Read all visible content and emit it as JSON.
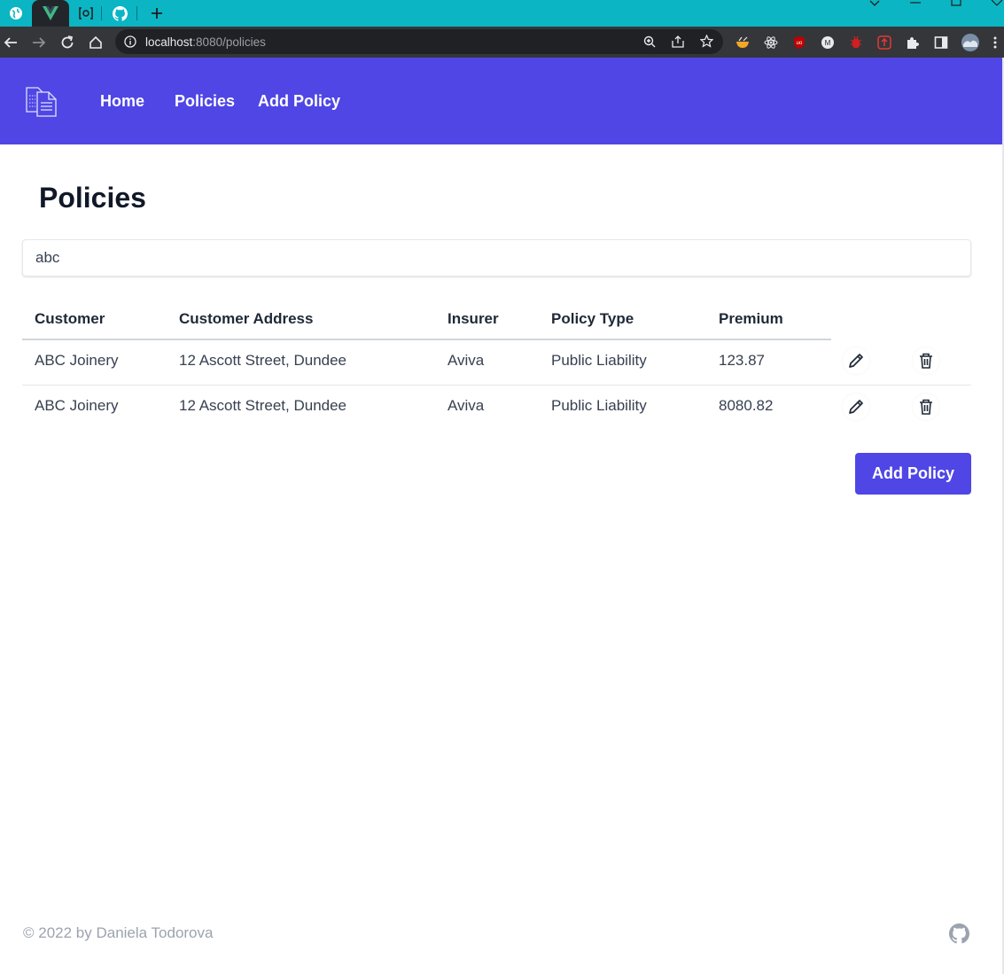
{
  "browser": {
    "url_host": "localhost",
    "url_path": ":8080/policies",
    "tabs": [
      {
        "icon": "globe-icon"
      },
      {
        "icon": "vue-icon",
        "active": true
      },
      {
        "icon": "podman-icon"
      },
      {
        "icon": "github-icon"
      }
    ],
    "new_tab": "+",
    "accent": "#0bb5c4"
  },
  "nav": {
    "brand_icon": "document-stack-icon",
    "links": [
      "Home",
      "Policies",
      "Add Policy"
    ],
    "color": "#4f46e5"
  },
  "page": {
    "title": "Policies",
    "search_value": "abc"
  },
  "table": {
    "columns": [
      "Customer",
      "Customer Address",
      "Insurer",
      "Policy Type",
      "Premium"
    ],
    "rows": [
      [
        "ABC Joinery",
        "12 Ascott Street, Dundee",
        "Aviva",
        "Public Liability",
        "123.87"
      ],
      [
        "ABC Joinery",
        "12 Ascott Street, Dundee",
        "Aviva",
        "Public Liability",
        "8080.82"
      ]
    ],
    "row_actions": [
      "pencil-icon",
      "trash-icon"
    ]
  },
  "actions": {
    "add_policy": "Add Policy"
  },
  "footer": {
    "copyright": "© 2022 by Daniela Todorova",
    "icon": "github-icon"
  }
}
